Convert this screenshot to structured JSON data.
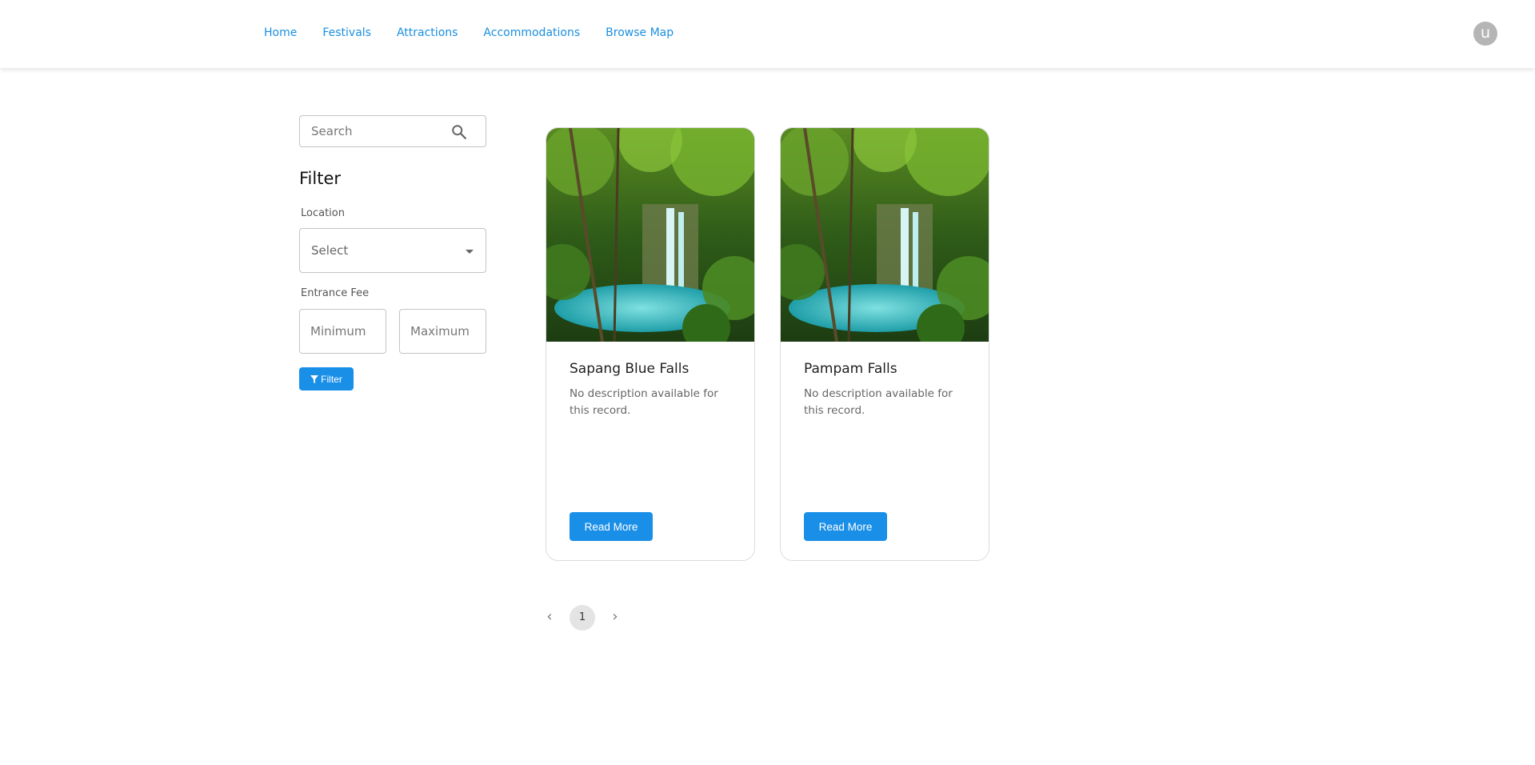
{
  "nav": {
    "items": [
      {
        "label": "Home"
      },
      {
        "label": "Festivals"
      },
      {
        "label": "Attractions"
      },
      {
        "label": "Accommodations"
      },
      {
        "label": "Browse Map"
      }
    ],
    "avatar_letter": "u"
  },
  "sidebar": {
    "search_placeholder": "Search",
    "filter_title": "Filter",
    "location_label": "Location",
    "location_value": "Select",
    "fee_label": "Entrance Fee",
    "min_placeholder": "Minimum",
    "max_placeholder": "Maximum",
    "filter_button": "Filter"
  },
  "cards": [
    {
      "title": "Sapang Blue Falls",
      "description": "No description available for this record.",
      "button": "Read More"
    },
    {
      "title": "Pampam Falls",
      "description": "No description available for this record.",
      "button": "Read More"
    }
  ],
  "pagination": {
    "current_page": "1"
  },
  "colors": {
    "accent": "#1a8fe8",
    "link": "#1a8fe0"
  }
}
